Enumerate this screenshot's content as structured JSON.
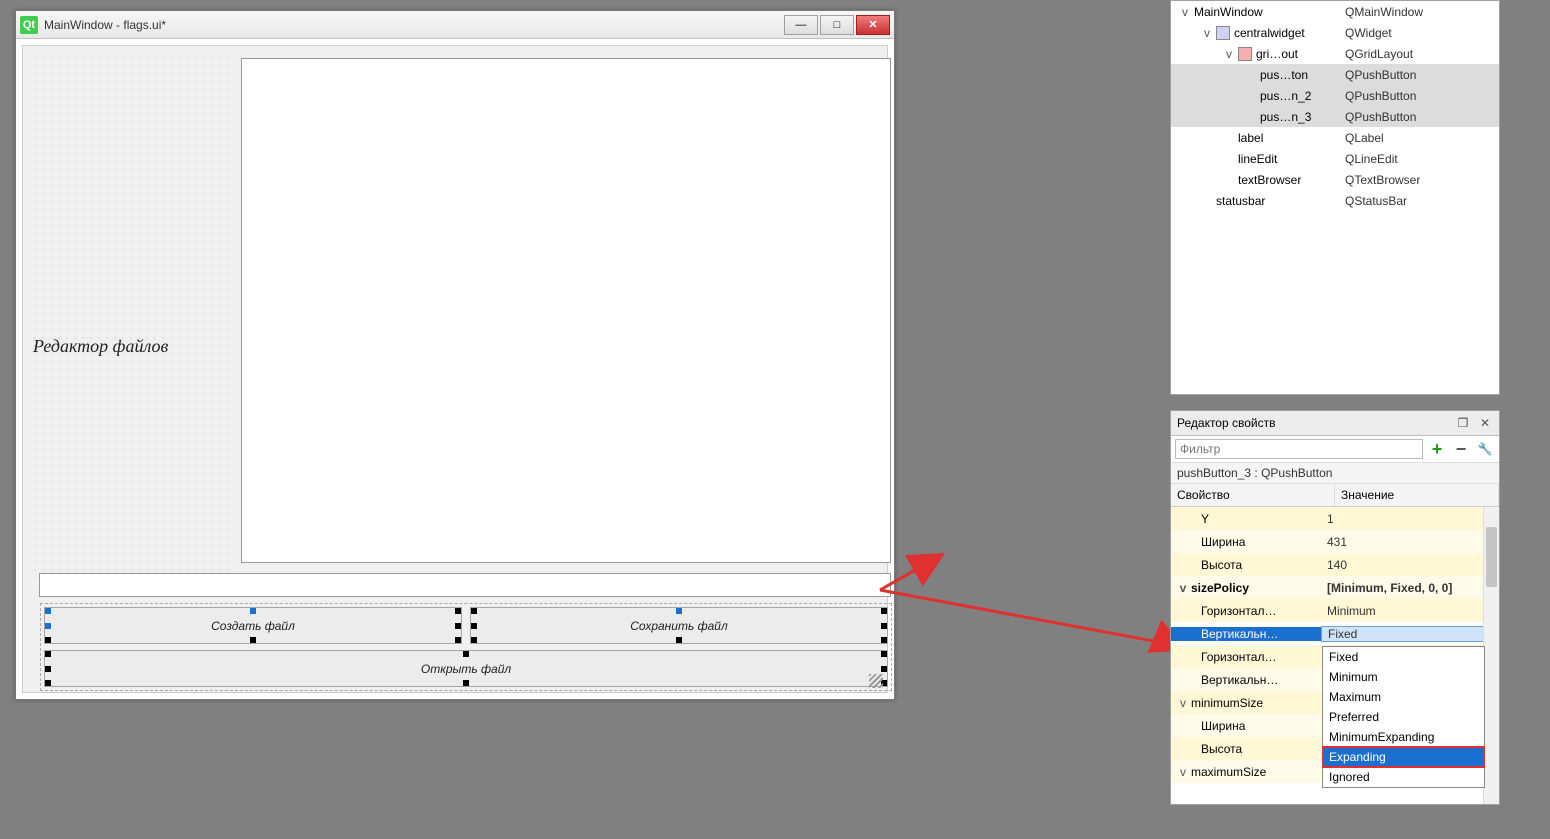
{
  "designerWindow": {
    "title": "MainWindow - flags.ui*",
    "label_fileeditor": "Редактор файлов",
    "btn_create": "Создать файл",
    "btn_save": "Сохранить файл",
    "btn_open": "Открыть файл"
  },
  "objectInspector": {
    "rows": [
      {
        "name": "MainWindow",
        "cls": "QMainWindow",
        "depth": 0,
        "expander": "v",
        "selected": false
      },
      {
        "name": "centralwidget",
        "cls": "QWidget",
        "depth": 1,
        "expander": "v",
        "selected": false,
        "icon": true
      },
      {
        "name": "gri…out",
        "cls": "QGridLayout",
        "depth": 2,
        "expander": "v",
        "selected": false,
        "icon": true,
        "layoutIcon": true
      },
      {
        "name": "pus…ton",
        "cls": "QPushButton",
        "depth": 3,
        "expander": "",
        "selected": true
      },
      {
        "name": "pus…n_2",
        "cls": "QPushButton",
        "depth": 3,
        "expander": "",
        "selected": true
      },
      {
        "name": "pus…n_3",
        "cls": "QPushButton",
        "depth": 3,
        "expander": "",
        "selected": true
      },
      {
        "name": "label",
        "cls": "QLabel",
        "depth": 2,
        "expander": "",
        "selected": false
      },
      {
        "name": "lineEdit",
        "cls": "QLineEdit",
        "depth": 2,
        "expander": "",
        "selected": false
      },
      {
        "name": "textBrowser",
        "cls": "QTextBrowser",
        "depth": 2,
        "expander": "",
        "selected": false
      },
      {
        "name": "statusbar",
        "cls": "QStatusBar",
        "depth": 1,
        "expander": "",
        "selected": false
      }
    ]
  },
  "propertyEditor": {
    "title": "Редактор свойств",
    "filter_placeholder": "Фильтр",
    "context": "pushButton_3 : QPushButton",
    "columns": {
      "prop": "Свойство",
      "val": "Значение"
    },
    "rows": [
      {
        "name": "Y",
        "val": "1",
        "style": "yellow",
        "pad": 2
      },
      {
        "name": "Ширина",
        "val": "431",
        "style": "yellow2",
        "pad": 2
      },
      {
        "name": "Высота",
        "val": "140",
        "style": "yellow",
        "pad": 2
      },
      {
        "name": "sizePolicy",
        "val": "[Minimum, Fixed, 0, 0]",
        "style": "yellow2",
        "pad": 0,
        "expander": "v",
        "bold": true
      },
      {
        "name": "Горизонтал…",
        "val": "Minimum",
        "style": "yellow",
        "pad": 2
      },
      {
        "name": "Вертикальн…",
        "val": "Fixed",
        "style": "sel",
        "pad": 2
      },
      {
        "name": "Горизонтал…",
        "val": "",
        "style": "yellow",
        "pad": 2
      },
      {
        "name": "Вертикальн…",
        "val": "",
        "style": "yellow2",
        "pad": 2
      },
      {
        "name": "minimumSize",
        "val": "",
        "style": "yellow",
        "pad": 0,
        "expander": "v"
      },
      {
        "name": "Ширина",
        "val": "",
        "style": "yellow2",
        "pad": 2
      },
      {
        "name": "Высота",
        "val": "",
        "style": "yellow",
        "pad": 2
      },
      {
        "name": "maximumSize",
        "val": "",
        "style": "yellow2",
        "pad": 0,
        "expander": "v"
      }
    ],
    "dropdown": {
      "options": [
        "Fixed",
        "Minimum",
        "Maximum",
        "Preferred",
        "MinimumExpanding",
        "Expanding",
        "Ignored"
      ],
      "highlighted": "Expanding",
      "boxed": "Expanding"
    }
  }
}
